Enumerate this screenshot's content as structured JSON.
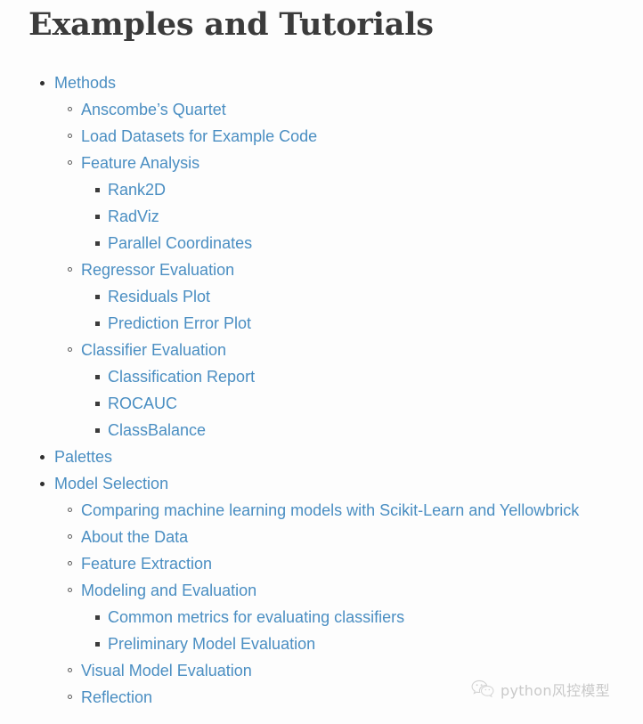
{
  "page": {
    "title": "Examples and Tutorials",
    "background_color": "#fdfdfd",
    "title_color": "#3b3b3b",
    "link_color": "#4a8ec2"
  },
  "toc": {
    "items": [
      {
        "label": "Methods",
        "level": 1,
        "children": [
          {
            "label": "Anscombe’s Quartet",
            "level": 2,
            "children": []
          },
          {
            "label": "Load Datasets for Example Code",
            "level": 2,
            "children": []
          },
          {
            "label": "Feature Analysis",
            "level": 2,
            "children": [
              {
                "label": "Rank2D",
                "level": 3
              },
              {
                "label": "RadViz",
                "level": 3
              },
              {
                "label": "Parallel Coordinates",
                "level": 3
              }
            ]
          },
          {
            "label": "Regressor Evaluation",
            "level": 2,
            "children": [
              {
                "label": "Residuals Plot",
                "level": 3
              },
              {
                "label": "Prediction Error Plot",
                "level": 3
              }
            ]
          },
          {
            "label": "Classifier Evaluation",
            "level": 2,
            "children": [
              {
                "label": "Classification Report",
                "level": 3
              },
              {
                "label": "ROCAUC",
                "level": 3
              },
              {
                "label": "ClassBalance",
                "level": 3
              }
            ]
          }
        ]
      },
      {
        "label": "Palettes",
        "level": 1,
        "children": []
      },
      {
        "label": "Model Selection",
        "level": 1,
        "children": [
          {
            "label": "Comparing machine learning models with Scikit-Learn and Yellowbrick",
            "level": 2,
            "children": []
          },
          {
            "label": "About the Data",
            "level": 2,
            "children": []
          },
          {
            "label": "Feature Extraction",
            "level": 2,
            "children": []
          },
          {
            "label": "Modeling and Evaluation",
            "level": 2,
            "children": [
              {
                "label": "Common metrics for evaluating classifiers",
                "level": 3
              },
              {
                "label": "Preliminary Model Evaluation",
                "level": 3
              }
            ]
          },
          {
            "label": "Visual Model Evaluation",
            "level": 2,
            "children": []
          },
          {
            "label": "Reflection",
            "level": 2,
            "children": []
          }
        ]
      }
    ]
  },
  "watermark": {
    "icon": "wechat-icon",
    "text": "python风控模型",
    "color": "#c9c9c9"
  }
}
